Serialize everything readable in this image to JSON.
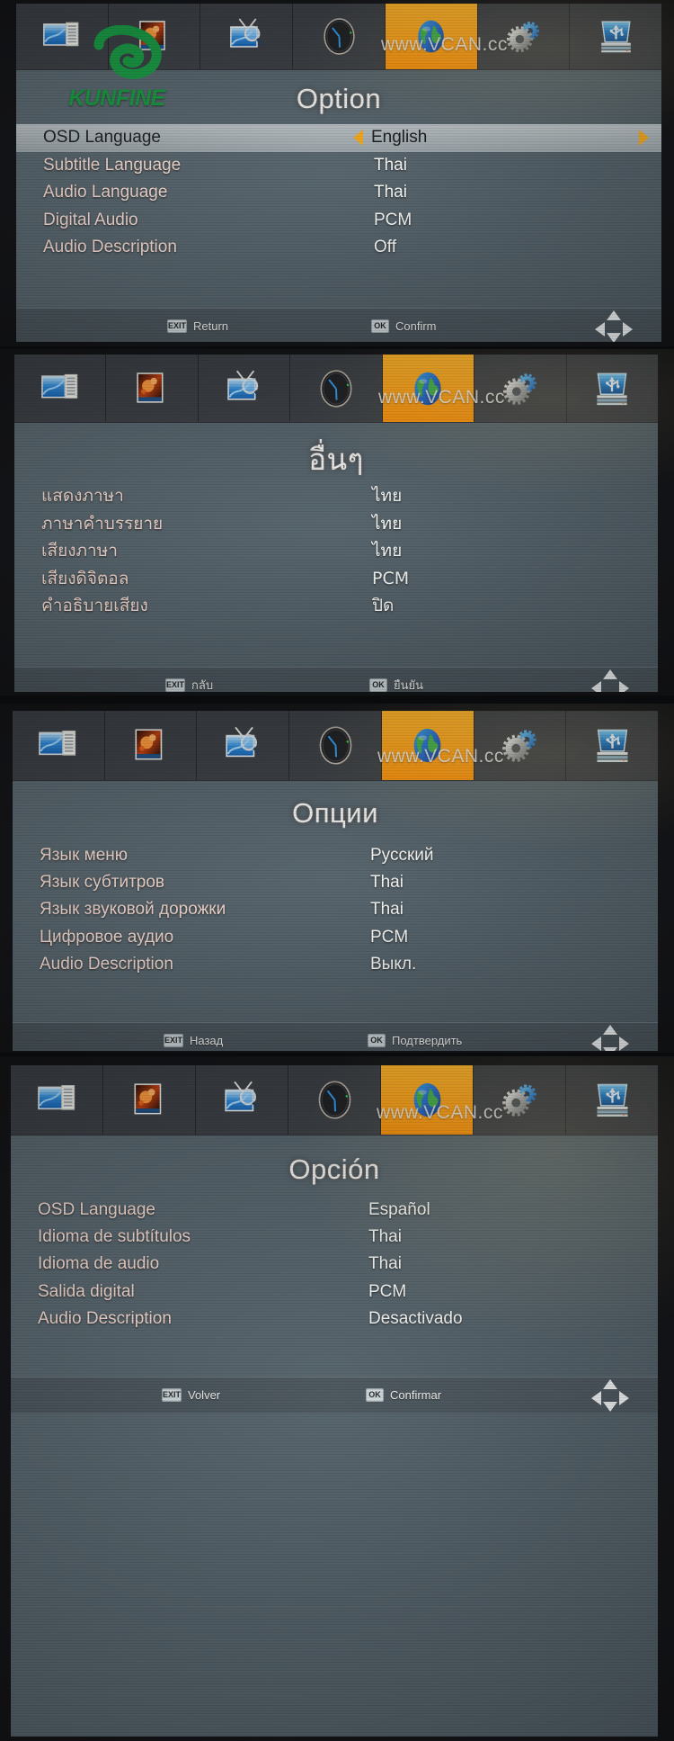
{
  "watermark": {
    "vcan": "www.VCAN.cc",
    "kunfine": "KUNFINE"
  },
  "iconbar": {
    "items": [
      {
        "name": "program-icon",
        "label": "Program"
      },
      {
        "name": "picture-icon",
        "label": "Picture"
      },
      {
        "name": "channel-search-icon",
        "label": "Channel Search"
      },
      {
        "name": "time-icon",
        "label": "Time"
      },
      {
        "name": "option-icon",
        "label": "Option"
      },
      {
        "name": "system-icon",
        "label": "System"
      },
      {
        "name": "usb-icon",
        "label": "USB"
      }
    ],
    "active_index": 4
  },
  "panels": [
    {
      "id": "english",
      "title": "Option",
      "show_kunfine": true,
      "rows": [
        {
          "label": "OSD Language",
          "value": "English",
          "selected": true,
          "arrows": true
        },
        {
          "label": "Subtitle Language",
          "value": "Thai",
          "selected": false,
          "arrows": false
        },
        {
          "label": "Audio Language",
          "value": "Thai",
          "selected": false,
          "arrows": false
        },
        {
          "label": "Digital Audio",
          "value": "PCM",
          "selected": false,
          "arrows": false
        },
        {
          "label": "Audio Description",
          "value": "Off",
          "selected": false,
          "arrows": false
        }
      ],
      "footer": {
        "exit_key": "EXIT",
        "exit_label": "Return",
        "ok_key": "OK",
        "ok_label": "Confirm"
      }
    },
    {
      "id": "thai",
      "title": "อื่นๆ",
      "thai": true,
      "show_kunfine": false,
      "rows": [
        {
          "label": "แสดงภาษา",
          "value": "ไทย",
          "selected": false,
          "arrows": false
        },
        {
          "label": "ภาษาคำบรรยาย",
          "value": "ไทย",
          "selected": false,
          "arrows": false
        },
        {
          "label": "เสียงภาษา",
          "value": "ไทย",
          "selected": false,
          "arrows": false
        },
        {
          "label": "เสียงดิจิตอล",
          "value": "PCM",
          "selected": false,
          "arrows": false
        },
        {
          "label": "คำอธิบายเสียง",
          "value": "ปิด",
          "selected": false,
          "arrows": false
        }
      ],
      "footer": {
        "exit_key": "EXIT",
        "exit_label": "กลับ",
        "ok_key": "OK",
        "ok_label": "ยืนยัน"
      }
    },
    {
      "id": "russian",
      "title": "Опции",
      "show_kunfine": false,
      "rows": [
        {
          "label": "Язык меню",
          "value": "Русский",
          "selected": false,
          "arrows": false
        },
        {
          "label": "Язык субтитров",
          "value": "Thai",
          "selected": false,
          "arrows": false
        },
        {
          "label": "Язык звуковой дорожки",
          "value": "Thai",
          "selected": false,
          "arrows": false
        },
        {
          "label": "Цифровое аудио",
          "value": "PCM",
          "selected": false,
          "arrows": false
        },
        {
          "label": "Audio Description",
          "value": "Выкл.",
          "selected": false,
          "arrows": false
        }
      ],
      "footer": {
        "exit_key": "EXIT",
        "exit_label": "Назад",
        "ok_key": "OK",
        "ok_label": "Подтвердить"
      }
    },
    {
      "id": "spanish",
      "title": "Opción",
      "show_kunfine": false,
      "rows": [
        {
          "label": "OSD Language",
          "value": "Español",
          "selected": false,
          "arrows": false
        },
        {
          "label": "Idioma de subtítulos",
          "value": "Thai",
          "selected": false,
          "arrows": false
        },
        {
          "label": "Idioma de audio",
          "value": "Thai",
          "selected": false,
          "arrows": false
        },
        {
          "label": "Salida digital",
          "value": "PCM",
          "selected": false,
          "arrows": false
        },
        {
          "label": "Audio Description",
          "value": "Desactivado",
          "selected": false,
          "arrows": false
        }
      ],
      "footer": {
        "exit_key": "EXIT",
        "exit_label": "Volver",
        "ok_key": "OK",
        "ok_label": "Confirmar"
      }
    }
  ],
  "colors": {
    "accent": "#f79a0d",
    "screen_bg": "#55636b",
    "iconbar_bg": "#3a3e43",
    "footer_bg": "#4a555c",
    "label": "#f7dcd2",
    "value": "#fbfbf8",
    "logo_green": "#159b3f",
    "arrow": "#f4a81b"
  }
}
